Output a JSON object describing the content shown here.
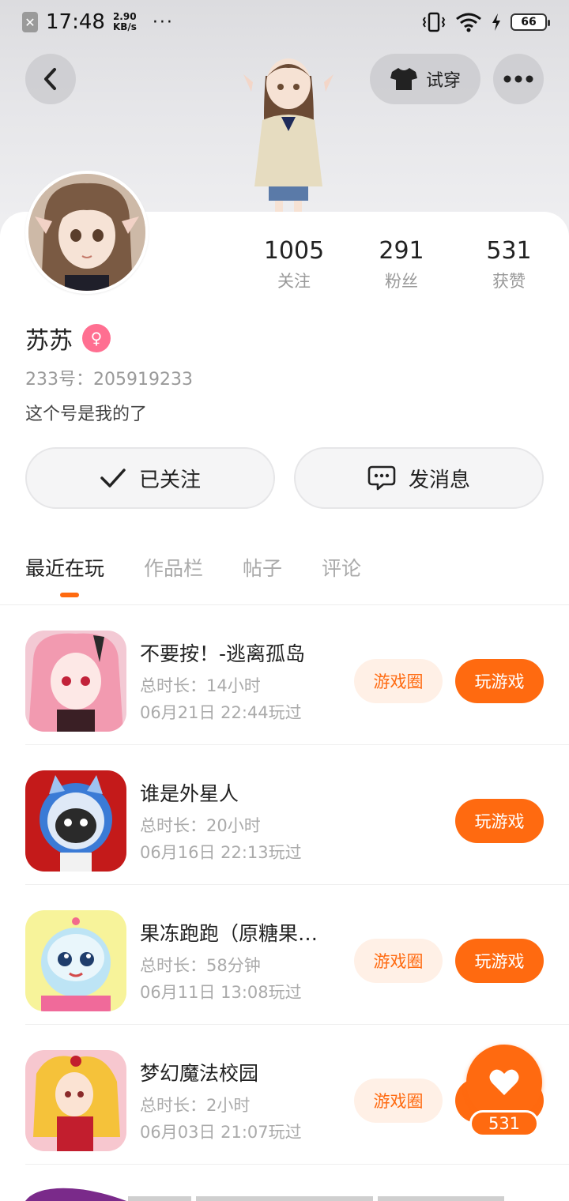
{
  "status_bar": {
    "time": "17:48",
    "speed_value": "2.90",
    "speed_unit": "KB/s",
    "dots": "···",
    "battery": "66"
  },
  "top_nav": {
    "tryon_label": "试穿"
  },
  "profile": {
    "username": "苏苏",
    "gender_symbol": "♀",
    "uid": "233号：205919233",
    "bio": "这个号是我的了",
    "stats": [
      {
        "value": "1005",
        "label": "关注"
      },
      {
        "value": "291",
        "label": "粉丝"
      },
      {
        "value": "531",
        "label": "获赞"
      }
    ]
  },
  "actions": {
    "follow_label": "已关注",
    "message_label": "发消息"
  },
  "tabs": [
    {
      "label": "最近在玩",
      "active": true
    },
    {
      "label": "作品栏",
      "active": false
    },
    {
      "label": "帖子",
      "active": false
    },
    {
      "label": "评论",
      "active": false
    }
  ],
  "games": [
    {
      "title": "不要按！-逃离孤岛",
      "duration": "总时长：14小时",
      "last_played": "06月21日 22:44玩过",
      "circle_label": "游戏圈",
      "play_label": "玩游戏"
    },
    {
      "title": "谁是外星人",
      "duration": "总时长：20小时",
      "last_played": "06月16日 22:13玩过",
      "circle_label": "",
      "play_label": "玩游戏"
    },
    {
      "title": "果冻跑跑（原糖果…",
      "duration": "总时长：58分钟",
      "last_played": "06月11日 13:08玩过",
      "circle_label": "游戏圈",
      "play_label": "玩游戏"
    },
    {
      "title": "梦幻魔法校园",
      "duration": "总时长：2小时",
      "last_played": "06月03日 21:07玩过",
      "circle_label": "游戏圈",
      "play_label": ""
    }
  ],
  "like_fab": {
    "count": "531"
  },
  "colors": {
    "accent": "#ff6a10",
    "accent_light": "#fff0e6",
    "gender_pink": "#ff6f91"
  }
}
